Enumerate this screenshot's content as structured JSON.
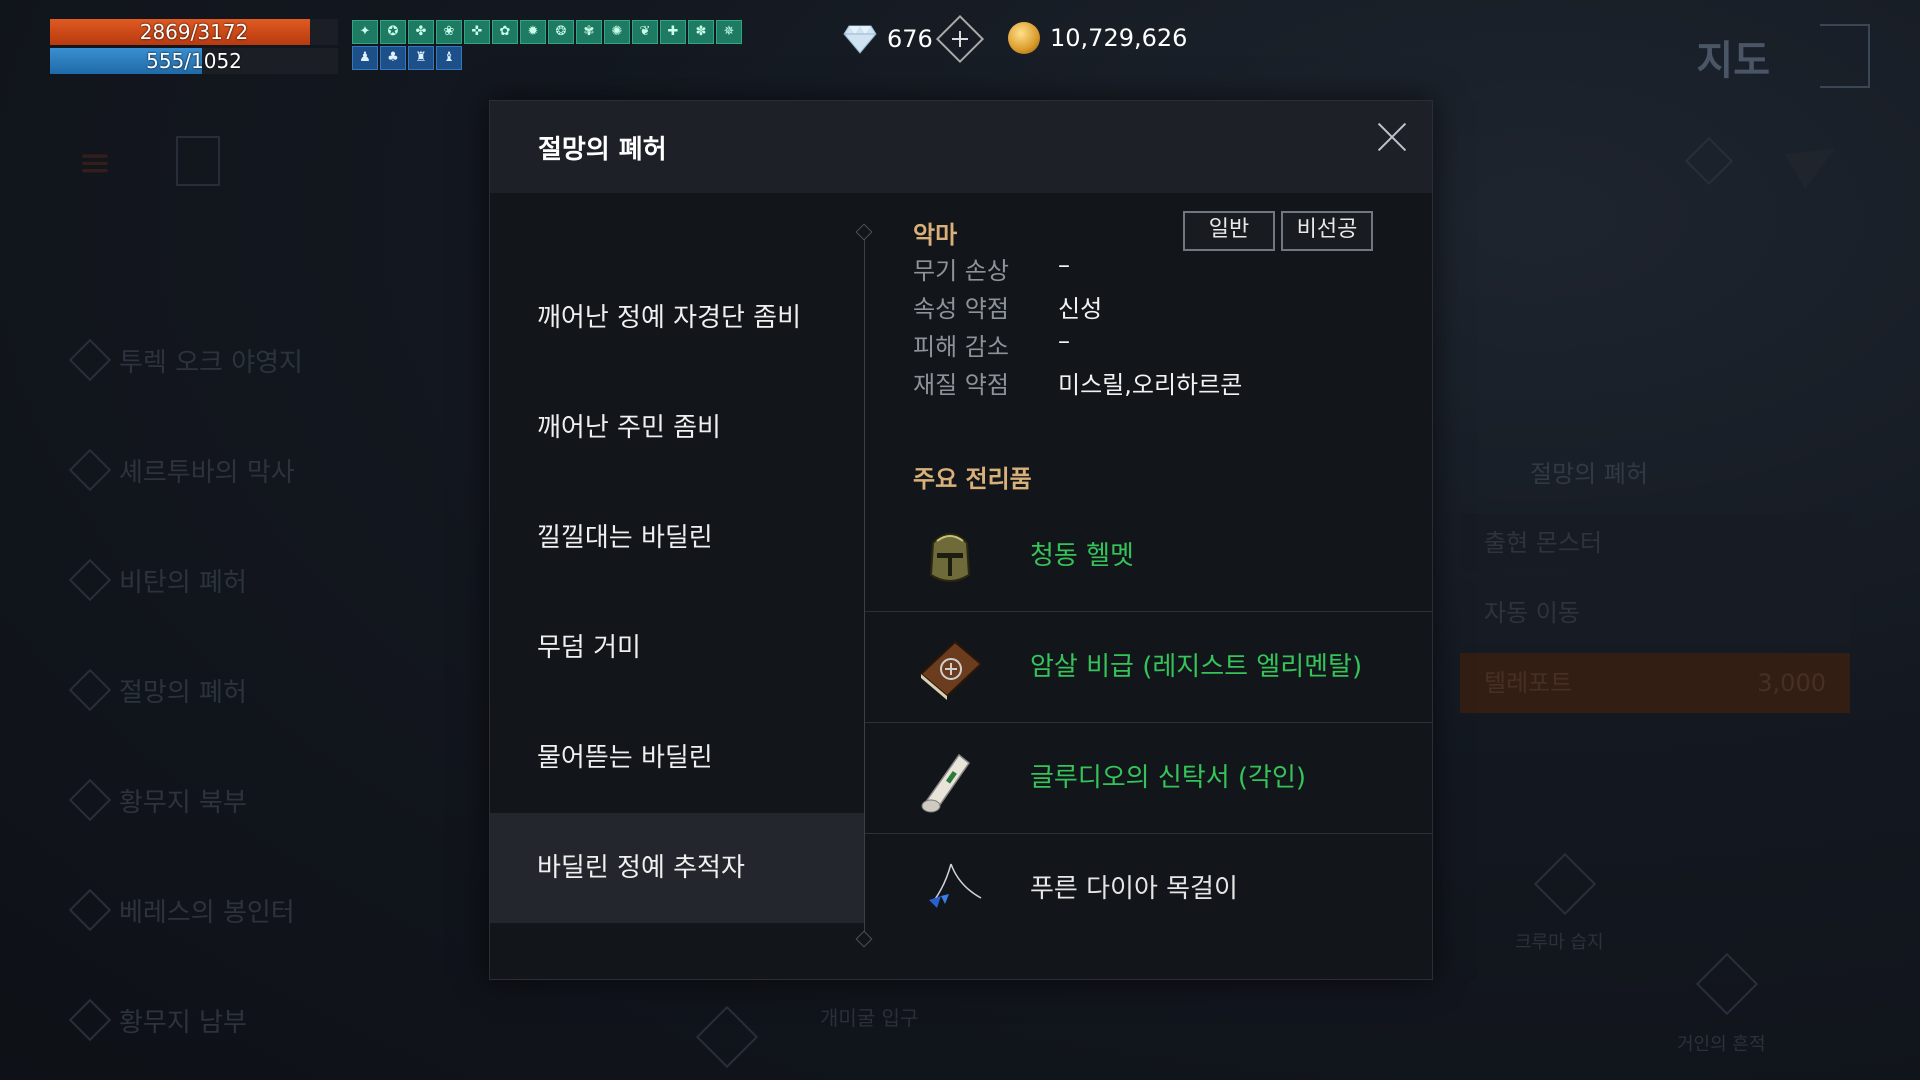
{
  "hud": {
    "hp_text": "2869/3172",
    "hp_fraction": 0.904,
    "mp_text": "555/1052",
    "mp_fraction": 0.527,
    "buff_row1": [
      "✦",
      "✪",
      "✤",
      "❀",
      "✜",
      "✿",
      "✹",
      "❂",
      "✾",
      "✺",
      "❦",
      "✚",
      "✽",
      "✵"
    ],
    "buff_row2": [
      "♟",
      "♣",
      "♜",
      "♝"
    ],
    "diamonds": "676",
    "gold": "10,729,626",
    "map_label": "지도"
  },
  "background": {
    "left_list": [
      "투렉 오크 야영지",
      "셰르투바의 막사",
      "비탄의 폐허",
      "절망의 폐허",
      "황무지 북부",
      "베레스의 봉인터",
      "황무지 남부"
    ],
    "right_panel": {
      "title": "절망의 폐허",
      "rows": [
        "출현 몬스터",
        "자동 이동"
      ],
      "teleport_label": "텔레포트",
      "teleport_cost": "3,000"
    },
    "markers": [
      "크루마 습지",
      "거인의 흔적",
      "개미굴 입구"
    ]
  },
  "dialog": {
    "title": "절망의 폐허",
    "monsters": [
      "깨어난 정예 자경단 좀비",
      "깨어난 주민 좀비",
      "낄낄대는 바딜린",
      "무덤 거미",
      "물어뜯는 바딜린",
      "바딜린 정예 추적자"
    ],
    "selected_index": 5,
    "race": "악마",
    "tags": [
      "일반",
      "비선공"
    ],
    "stats": [
      {
        "label": "무기 손상",
        "value": "–"
      },
      {
        "label": "속성 약점",
        "value": "신성"
      },
      {
        "label": "피해 감소",
        "value": "–"
      },
      {
        "label": "재질 약점",
        "value": "미스릴,오리하르콘"
      }
    ],
    "loot_title": "주요 전리품",
    "loot": [
      {
        "name": "청동 헬멧",
        "icon": "helmet-icon",
        "grade_color": "#35c45a"
      },
      {
        "name": "암살 비급 (레지스트 엘리멘탈)",
        "icon": "spellbook-icon",
        "grade_color": "#35c45a"
      },
      {
        "name": "글루디오의 신탁서 (각인)",
        "icon": "scroll-icon",
        "grade_color": "#35c45a"
      },
      {
        "name": "푸른 다이아 목걸이",
        "icon": "necklace-icon",
        "grade_color": "#e6e6e6"
      }
    ]
  }
}
